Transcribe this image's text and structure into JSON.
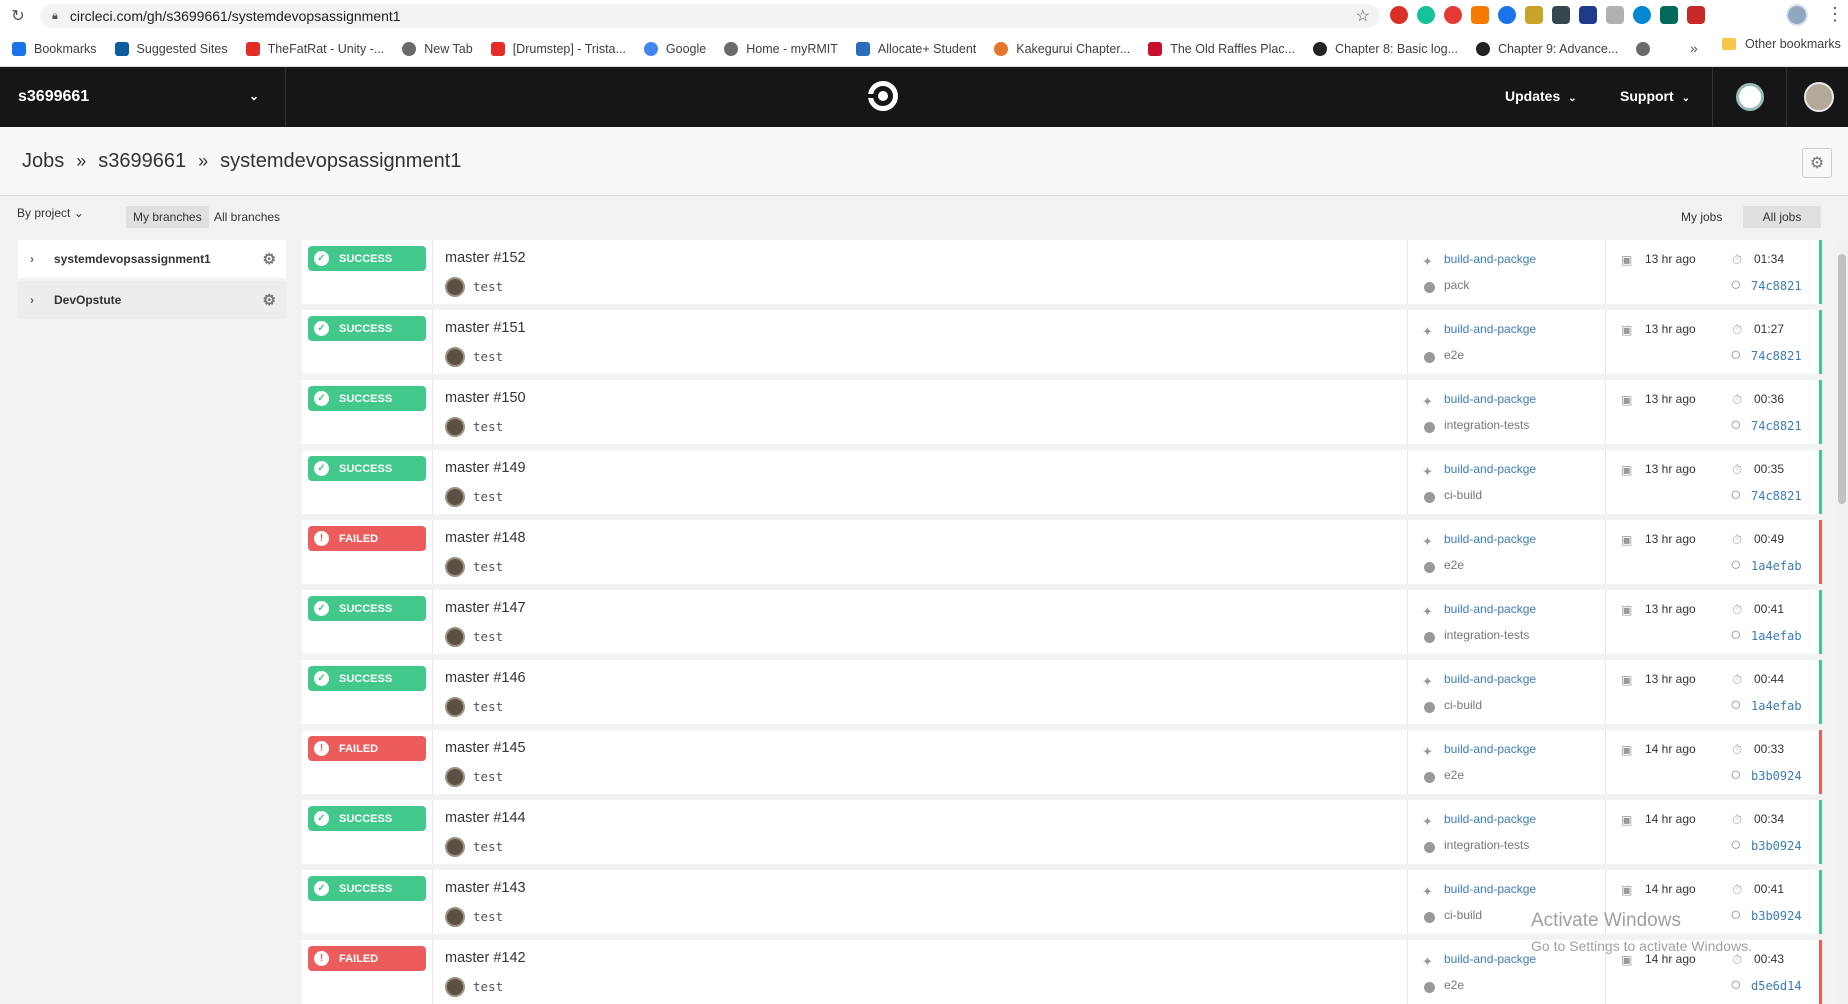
{
  "browser": {
    "url": "circleci.com/gh/s3699661/systemdevopsassignment1",
    "bookmarks": [
      {
        "label": "Bookmarks",
        "color": "#1a73e8"
      },
      {
        "label": "Suggested Sites",
        "color": "#0c5c9e"
      },
      {
        "label": "TheFatRat - Unity -...",
        "color": "#e52d27"
      },
      {
        "label": "New Tab",
        "color": "#6b6b6b"
      },
      {
        "label": "[Drumstep] - Trista...",
        "color": "#e52d27"
      },
      {
        "label": "Google",
        "color": "#4285f4"
      },
      {
        "label": "Home - myRMIT",
        "color": "#6b6b6b"
      },
      {
        "label": "Allocate+ Student",
        "color": "#2a6ebb"
      },
      {
        "label": "Kakegurui Chapter...",
        "color": "#e4752a"
      },
      {
        "label": "The Old Raffles Plac...",
        "color": "#c8102e"
      },
      {
        "label": "Chapter 8: Basic log...",
        "color": "#222222"
      },
      {
        "label": "Chapter 9: Advance...",
        "color": "#222222"
      }
    ],
    "other_bookmarks": "Other bookmarks"
  },
  "header": {
    "org": "s3699661",
    "nav_updates": "Updates",
    "nav_support": "Support"
  },
  "breadcrumb": {
    "jobs": "Jobs",
    "sep": "»",
    "org": "s3699661",
    "project": "systemdevopsassignment1"
  },
  "filters": {
    "by_project": "By project",
    "my_branches": "My branches",
    "all_branches": "All branches",
    "my_jobs": "My jobs",
    "all_jobs": "All jobs"
  },
  "projects": [
    {
      "name": "systemdevopsassignment1"
    },
    {
      "name": "DevOpstute"
    }
  ],
  "colors": {
    "success": "#42c88a",
    "failed": "#ed5c5c",
    "link": "#3c7cb5",
    "header_bg": "#161616"
  },
  "jobs": [
    {
      "status": "SUCCESS",
      "title": "master #152",
      "commit": "test",
      "workflow": "build-and-packge",
      "job": "pack",
      "time": "13 hr ago",
      "duration": "01:34",
      "sha": "74c8821"
    },
    {
      "status": "SUCCESS",
      "title": "master #151",
      "commit": "test",
      "workflow": "build-and-packge",
      "job": "e2e",
      "time": "13 hr ago",
      "duration": "01:27",
      "sha": "74c8821"
    },
    {
      "status": "SUCCESS",
      "title": "master #150",
      "commit": "test",
      "workflow": "build-and-packge",
      "job": "integration-tests",
      "time": "13 hr ago",
      "duration": "00:36",
      "sha": "74c8821"
    },
    {
      "status": "SUCCESS",
      "title": "master #149",
      "commit": "test",
      "workflow": "build-and-packge",
      "job": "ci-build",
      "time": "13 hr ago",
      "duration": "00:35",
      "sha": "74c8821"
    },
    {
      "status": "FAILED",
      "title": "master #148",
      "commit": "test",
      "workflow": "build-and-packge",
      "job": "e2e",
      "time": "13 hr ago",
      "duration": "00:49",
      "sha": "1a4efab"
    },
    {
      "status": "SUCCESS",
      "title": "master #147",
      "commit": "test",
      "workflow": "build-and-packge",
      "job": "integration-tests",
      "time": "13 hr ago",
      "duration": "00:41",
      "sha": "1a4efab"
    },
    {
      "status": "SUCCESS",
      "title": "master #146",
      "commit": "test",
      "workflow": "build-and-packge",
      "job": "ci-build",
      "time": "13 hr ago",
      "duration": "00:44",
      "sha": "1a4efab"
    },
    {
      "status": "FAILED",
      "title": "master #145",
      "commit": "test",
      "workflow": "build-and-packge",
      "job": "e2e",
      "time": "14 hr ago",
      "duration": "00:33",
      "sha": "b3b0924"
    },
    {
      "status": "SUCCESS",
      "title": "master #144",
      "commit": "test",
      "workflow": "build-and-packge",
      "job": "integration-tests",
      "time": "14 hr ago",
      "duration": "00:34",
      "sha": "b3b0924"
    },
    {
      "status": "SUCCESS",
      "title": "master #143",
      "commit": "test",
      "workflow": "build-and-packge",
      "job": "ci-build",
      "time": "14 hr ago",
      "duration": "00:41",
      "sha": "b3b0924"
    },
    {
      "status": "FAILED",
      "title": "master #142",
      "commit": "test",
      "workflow": "build-and-packge",
      "job": "e2e",
      "time": "14 hr ago",
      "duration": "00:43",
      "sha": "d5e6d14"
    }
  ],
  "watermark": {
    "line1": "Activate Windows",
    "line2": "Go to Settings to activate Windows."
  }
}
